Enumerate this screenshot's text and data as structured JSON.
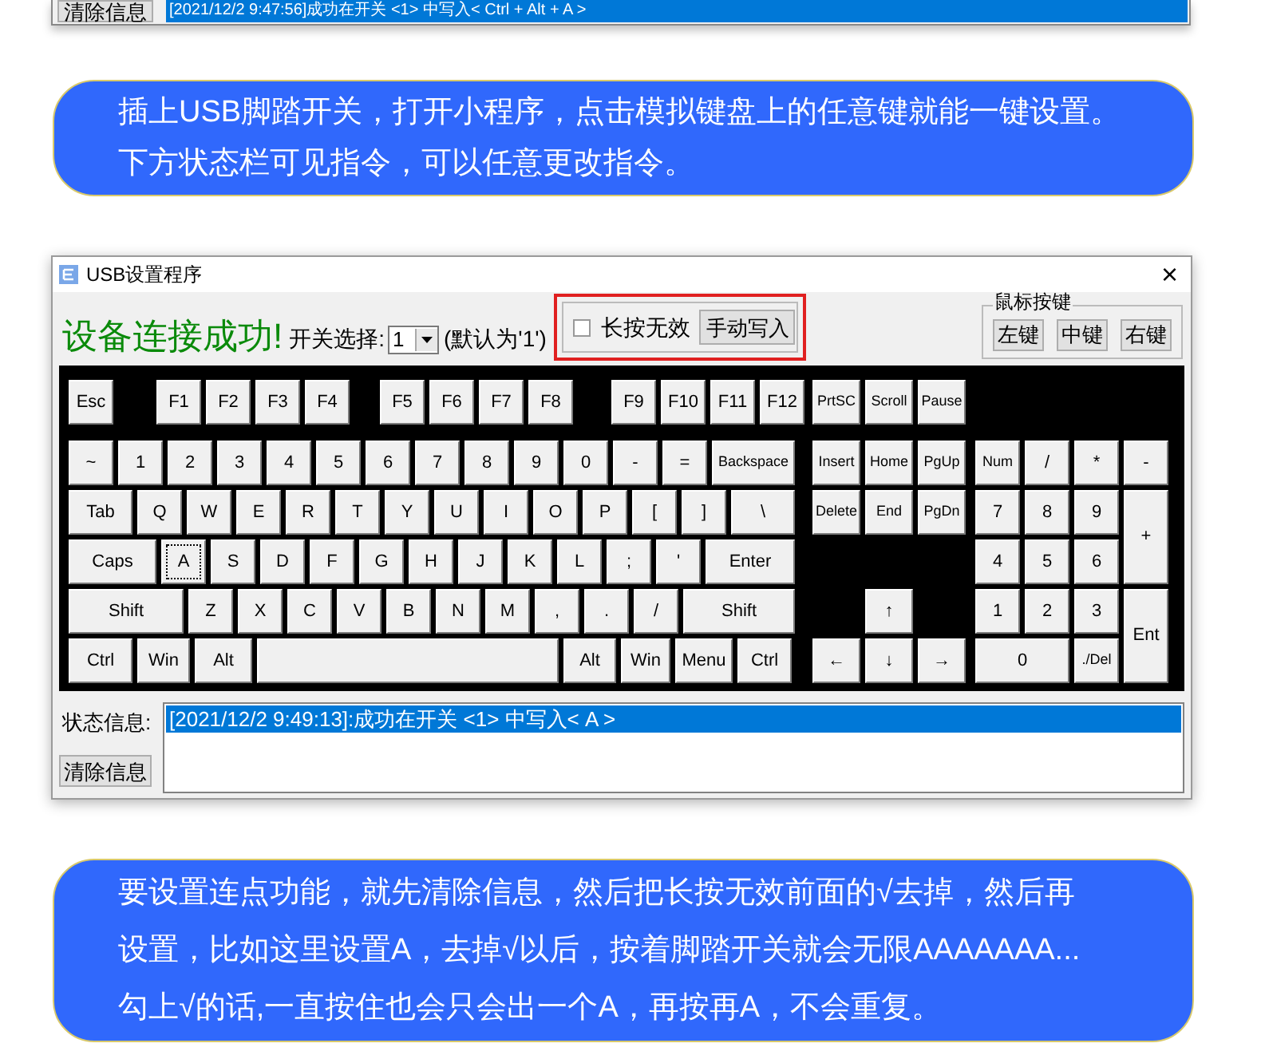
{
  "prev_window": {
    "clear_button": "清除信息",
    "status_line": "[2021/12/2 9:47:56]成功在开关 <1> 中写入< Ctrl + Alt + A >"
  },
  "note_top": {
    "lines": [
      "插上USB脚踏开关，打开小程序，点击模拟键盘上的任意键就能一键设置。",
      "下方状态栏可见指令，可以任意更改指令。"
    ]
  },
  "window": {
    "title": "USB设置程序",
    "close": "×",
    "header": {
      "status": "设备连接成功!",
      "switch_label": "开关选择:",
      "switch_value": "1",
      "default_note": "(默认为'1')",
      "long_press": {
        "label": "长按无效",
        "checked": false
      },
      "manual_write": "手动写入",
      "mouse_group": {
        "title": "鼠标按键",
        "buttons": [
          "左键",
          "中键",
          "右键"
        ]
      }
    },
    "keyboard": {
      "main_rows": [
        [
          {
            "label": "Esc",
            "focused": false
          },
          {
            "label": "F1",
            "focused": false
          },
          {
            "label": "F2",
            "focused": false
          },
          {
            "label": "F3",
            "focused": false
          },
          {
            "label": "F4",
            "focused": false
          },
          {
            "label": "F5",
            "focused": false
          },
          {
            "label": "F6",
            "focused": false
          },
          {
            "label": "F7",
            "focused": false
          },
          {
            "label": "F8",
            "focused": false
          },
          {
            "label": "F9",
            "focused": false
          },
          {
            "label": "F10",
            "focused": false
          },
          {
            "label": "F11",
            "focused": false
          },
          {
            "label": "F12",
            "focused": false
          }
        ],
        [
          {
            "label": "~",
            "focused": false
          },
          {
            "label": "1",
            "focused": false
          },
          {
            "label": "2",
            "focused": false
          },
          {
            "label": "3",
            "focused": false
          },
          {
            "label": "4",
            "focused": false
          },
          {
            "label": "5",
            "focused": false
          },
          {
            "label": "6",
            "focused": false
          },
          {
            "label": "7",
            "focused": false
          },
          {
            "label": "8",
            "focused": false
          },
          {
            "label": "9",
            "focused": false
          },
          {
            "label": "0",
            "focused": false
          },
          {
            "label": "-",
            "focused": false
          },
          {
            "label": "=",
            "focused": false
          },
          {
            "label": "Backspace",
            "focused": false
          }
        ],
        [
          {
            "label": "Tab",
            "focused": false
          },
          {
            "label": "Q",
            "focused": false
          },
          {
            "label": "W",
            "focused": false
          },
          {
            "label": "E",
            "focused": false
          },
          {
            "label": "R",
            "focused": false
          },
          {
            "label": "T",
            "focused": false
          },
          {
            "label": "Y",
            "focused": false
          },
          {
            "label": "U",
            "focused": false
          },
          {
            "label": "I",
            "focused": false
          },
          {
            "label": "O",
            "focused": false
          },
          {
            "label": "P",
            "focused": false
          },
          {
            "label": "[",
            "focused": false
          },
          {
            "label": "]",
            "focused": false
          },
          {
            "label": "\\",
            "focused": false
          }
        ],
        [
          {
            "label": "Caps",
            "focused": false
          },
          {
            "label": "A",
            "focused": true
          },
          {
            "label": "S",
            "focused": false
          },
          {
            "label": "D",
            "focused": false
          },
          {
            "label": "F",
            "focused": false
          },
          {
            "label": "G",
            "focused": false
          },
          {
            "label": "H",
            "focused": false
          },
          {
            "label": "J",
            "focused": false
          },
          {
            "label": "K",
            "focused": false
          },
          {
            "label": "L",
            "focused": false
          },
          {
            "label": ";",
            "focused": false
          },
          {
            "label": "'",
            "focused": false
          },
          {
            "label": "Enter",
            "focused": false
          }
        ],
        [
          {
            "label": "Shift",
            "focused": false
          },
          {
            "label": "Z",
            "focused": false
          },
          {
            "label": "X",
            "focused": false
          },
          {
            "label": "C",
            "focused": false
          },
          {
            "label": "V",
            "focused": false
          },
          {
            "label": "B",
            "focused": false
          },
          {
            "label": "N",
            "focused": false
          },
          {
            "label": "M",
            "focused": false
          },
          {
            "label": ",",
            "focused": false
          },
          {
            "label": ".",
            "focused": false
          },
          {
            "label": "/",
            "focused": false
          },
          {
            "label": "Shift",
            "focused": false
          }
        ],
        [
          {
            "label": "Ctrl",
            "focused": false
          },
          {
            "label": "Win",
            "focused": false
          },
          {
            "label": "Alt",
            "focused": false
          },
          {
            "label": "Alt",
            "focused": false
          },
          {
            "label": "Win",
            "focused": false
          },
          {
            "label": "Menu",
            "focused": false
          },
          {
            "label": "Ctrl",
            "focused": false
          }
        ]
      ],
      "nav_keys": [
        {
          "label": "PrtSC",
          "focused": false
        },
        {
          "label": "Scroll",
          "focused": false
        },
        {
          "label": "Pause",
          "focused": false
        },
        {
          "label": "Insert",
          "focused": false
        },
        {
          "label": "Home",
          "focused": false
        },
        {
          "label": "PgUp",
          "focused": false
        },
        {
          "label": "Delete",
          "focused": false
        },
        {
          "label": "End",
          "focused": false
        },
        {
          "label": "PgDn",
          "focused": false
        },
        {
          "label": "↑",
          "focused": false
        },
        {
          "label": "←",
          "focused": false
        },
        {
          "label": "↓",
          "focused": false
        },
        {
          "label": "→",
          "focused": false
        }
      ],
      "numpad_keys": [
        {
          "label": "Num",
          "focused": false
        },
        {
          "label": "/",
          "focused": false
        },
        {
          "label": "*",
          "focused": false
        },
        {
          "label": "-",
          "focused": false
        },
        {
          "label": "7",
          "focused": false
        },
        {
          "label": "8",
          "focused": false
        },
        {
          "label": "9",
          "focused": false
        },
        {
          "label": "+",
          "focused": false
        },
        {
          "label": "4",
          "focused": false
        },
        {
          "label": "5",
          "focused": false
        },
        {
          "label": "6",
          "focused": false
        },
        {
          "label": "1",
          "focused": false
        },
        {
          "label": "2",
          "focused": false
        },
        {
          "label": "3",
          "focused": false
        },
        {
          "label": "Ent",
          "focused": false
        },
        {
          "label": "0",
          "focused": false
        },
        {
          "label": "./Del",
          "focused": false
        }
      ]
    },
    "status": {
      "label": "状态信息:",
      "items": [
        {
          "text": "[2021/12/2 9:49:13]:成功在开关 <1> 中写入< A >",
          "selected": true
        }
      ],
      "clear_button": "清除信息"
    }
  },
  "note_bottom": {
    "lines": [
      "要设置连点功能，就先清除信息，然后把长按无效前面的√去掉，然后再",
      "设置，比如这里设置A，去掉√以后，按着脚踏开关就会无限AAAAAAA...",
      "勾上√的话,一直按住也会只会出一个A，再按再A，不会重复。"
    ]
  }
}
